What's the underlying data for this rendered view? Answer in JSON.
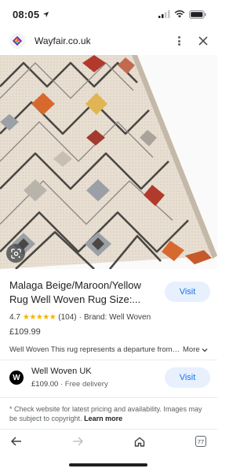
{
  "status_bar": {
    "time": "08:05",
    "icons": [
      "location-arrow-icon",
      "signal-icon",
      "wifi-icon",
      "battery-icon"
    ]
  },
  "url_bar": {
    "domain": "Wayfair.co.uk",
    "favicon": "wayfair-favicon-icon",
    "more_icon": "more-vert-icon",
    "close_icon": "close-icon"
  },
  "product": {
    "image_alt": "rug-image",
    "lens_icon": "google-lens-icon",
    "title": "Malaga Beige/Maroon/Yellow Rug Well Woven Rug Size:...",
    "visit_label": "Visit",
    "rating_value": "4.7",
    "rating_stars": "★★★★★",
    "rating_count": "(104)",
    "brand_separator": "·",
    "brand": "Brand: Well Woven",
    "price": "£109.99",
    "description": "Well Woven This rug represents a departure from the...",
    "more_label": "More"
  },
  "seller": {
    "logo_letter": "W",
    "name": "Well Woven UK",
    "price": "£109.00",
    "separator": "·",
    "delivery": "Free delivery",
    "visit_label": "Visit"
  },
  "disclaimer": {
    "text": "* Check website for latest pricing and availability. Images may be subject to copyright.",
    "learn_more": "Learn more"
  },
  "bottom_bar": {
    "tab_count": "77",
    "icons": [
      "back-arrow-icon",
      "forward-arrow-icon",
      "home-icon",
      "tabs-icon"
    ]
  },
  "colors": {
    "accent": "#1a73e8",
    "button_bg": "#e8f0fe",
    "star": "#f4b400",
    "rug_beige": "#e7ddd0",
    "rug_maroon": "#b23a2c",
    "rug_yellow": "#e2b554",
    "rug_orange": "#d8692e",
    "rug_grey": "#9aa0a6"
  }
}
